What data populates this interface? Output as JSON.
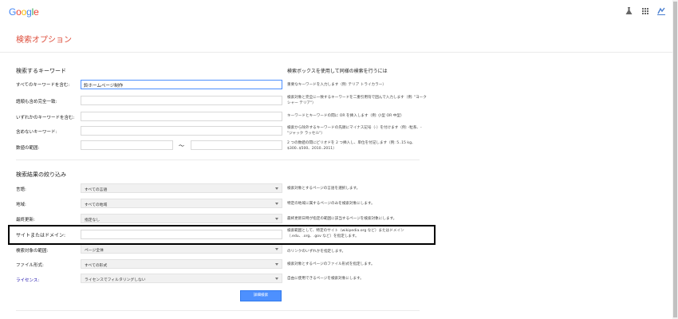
{
  "header": {
    "logo_letters": [
      {
        "ch": "G",
        "color": "#4285f4"
      },
      {
        "ch": "o",
        "color": "#ea4335"
      },
      {
        "ch": "o",
        "color": "#fbbc05"
      },
      {
        "ch": "g",
        "color": "#4285f4"
      },
      {
        "ch": "l",
        "color": "#34a853"
      },
      {
        "ch": "e",
        "color": "#ea4335"
      }
    ],
    "flask_icon": "flask-icon",
    "apps_icon": "apps-grid-icon",
    "avatar_icon": "avatar-icon"
  },
  "page_title": "検索オプション",
  "keywords": {
    "section_title": "検索するキーワード",
    "section_hint": "検索ボックスを使用して同様の検索を行うには",
    "all_words": {
      "label": "すべてのキーワードを含む:",
      "value": "鈴ホームページ制作",
      "hint": "重要なキーワードを入力します（例: テリア トライカラー）"
    },
    "exact": {
      "label": "語順も含め完全一致:",
      "value": "",
      "hint": "検索対象と完全に一致するキーワードを二重引用符で囲んで入力します（例: \"ヨークシャー テリア\"）"
    },
    "any": {
      "label": "いずれかのキーワードを含む:",
      "value": "",
      "hint": "キーワードとキーワードの間に OR を挿入します（例: 小型 OR 中型）"
    },
    "none": {
      "label": "含めないキーワード:",
      "value": "",
      "hint": "検索から除外するキーワードの先頭にマイナス記号（-）を付けます（例: -粒系、-\"ジャック ラッセル\"）"
    },
    "range": {
      "label": "数値の範囲:",
      "from": "",
      "sep": "〜",
      "to": "",
      "hint": "2 つの数値の間にピリオドを 2 つ挿入し、単位を付記します（例: 5..15 kg、$300..$500、2010..2011）"
    }
  },
  "narrow": {
    "section_title": "検索結果の絞り込み",
    "language": {
      "label": "言語:",
      "value": "すべての言語",
      "hint": "検索対象とするページの言語を選択します。"
    },
    "region": {
      "label": "地域:",
      "value": "すべての地域",
      "hint": "特定の地域に属するページのみを検索対象にします。"
    },
    "last_update": {
      "label": "最終更新:",
      "value": "指定なし",
      "hint": "最終更新日時が指定の範囲に該当するページを検索対象にします。"
    },
    "site": {
      "label": "サイトまたはドメイン:",
      "value": "",
      "hint": "検索範囲として、特定のサイト（wikipedia.org など）またはドメイン（.edu、.org、.gov など）を指定します。"
    },
    "terms_appear": {
      "label": "検索対象の範囲:",
      "value": "ページ全体",
      "hint": "のリンクのいずれかを指定します。"
    },
    "file_type": {
      "label": "ファイル形式:",
      "value": "すべての形式",
      "hint": "検索対象とするページのファイル形式を指定します。"
    },
    "license": {
      "label": "ライセンス:",
      "value": "ライセンスでフィルタリングしない",
      "hint": "自由に使用できるページを検索対象にします。"
    }
  },
  "submit_label": "詳細検索"
}
